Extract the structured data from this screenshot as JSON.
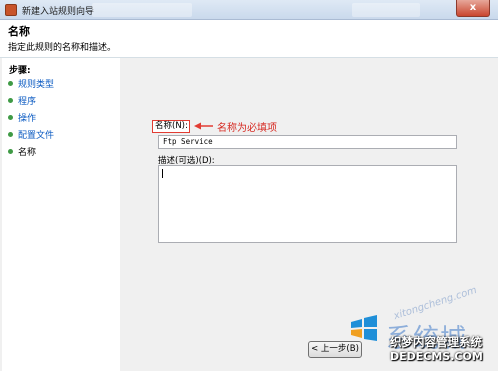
{
  "window": {
    "title": "新建入站规则向导",
    "close_glyph": "x"
  },
  "header": {
    "heading": "名称",
    "description": "指定此规则的名称和描述。"
  },
  "steps": {
    "title": "步骤:",
    "items": [
      {
        "label": "规则类型",
        "state": "link"
      },
      {
        "label": "程序",
        "state": "link"
      },
      {
        "label": "操作",
        "state": "link"
      },
      {
        "label": "配置文件",
        "state": "link"
      },
      {
        "label": "名称",
        "state": "current"
      }
    ]
  },
  "form": {
    "name_label": "名称(N):",
    "name_value": "Ftp Service",
    "annotation": "名称为必填项",
    "description_label": "描述(可选)(D):",
    "description_value": ""
  },
  "buttons": {
    "back": "< 上一步(B)"
  },
  "watermark": {
    "brand": "系统城",
    "url": "xitongcheng.com",
    "cn_text": "织梦内容管理系统",
    "site": "DEDECMS.COM"
  },
  "colors": {
    "annotation_red": "#e23c33",
    "link_blue": "#0a5ac2",
    "bullet_green": "#3f9a45"
  }
}
